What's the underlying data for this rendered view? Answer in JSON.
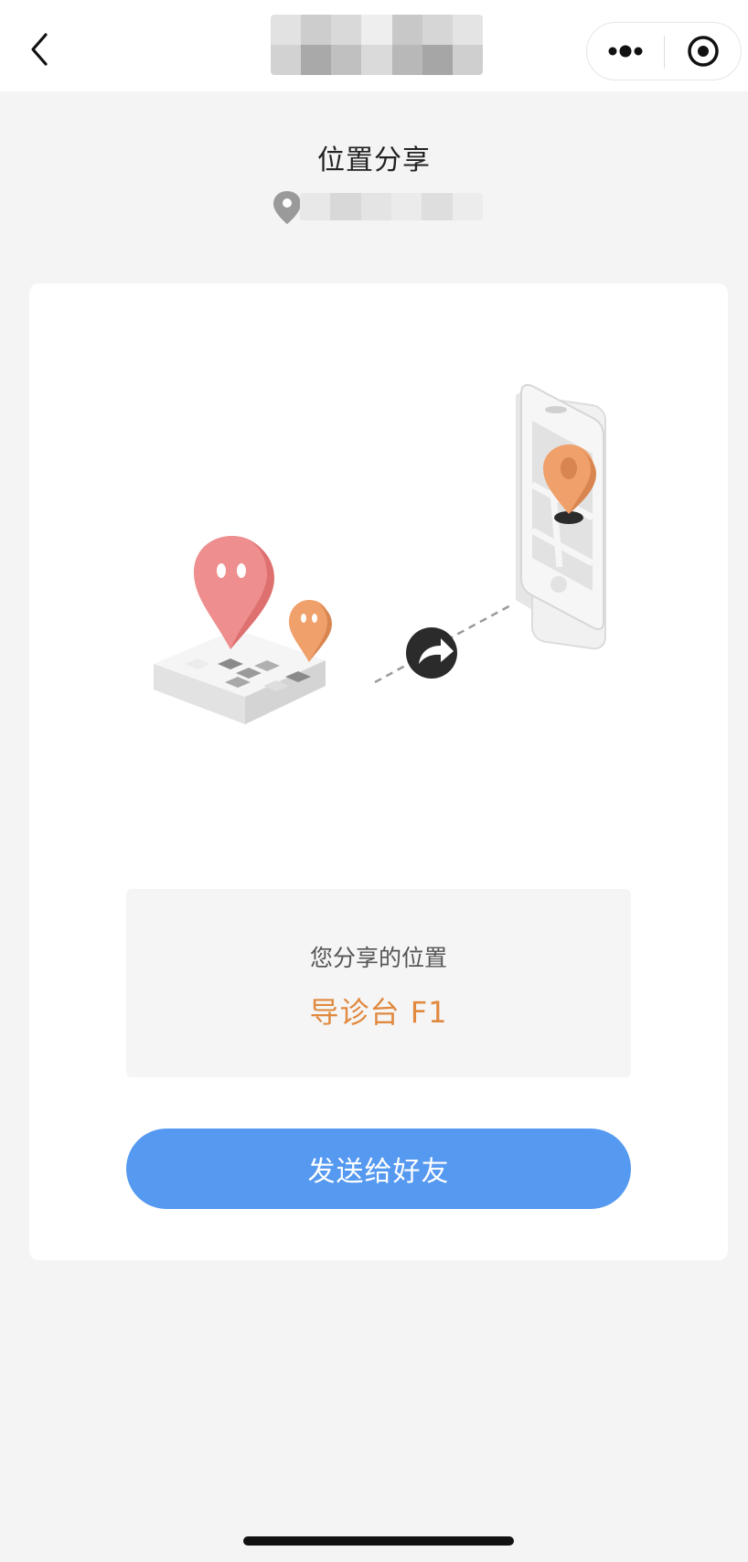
{
  "nav": {
    "back_icon": "chevron-left-icon",
    "more_icon": "more-dots-icon",
    "close_icon": "target-circle-icon",
    "title_mosaic": [
      "#e2e2e2",
      "#cdcdcd",
      "#d9d9d9",
      "#eeeeee",
      "#c8c8c8",
      "#d6d6d6",
      "#e4e4e4",
      "#d2d2d2",
      "#a9a9a9",
      "#c0c0c0",
      "#dadada",
      "#b8b8b8",
      "#a6a6a6",
      "#cfcfcf"
    ]
  },
  "header": {
    "title": "位置分享",
    "location_icon": "map-pin-icon"
  },
  "card": {
    "info_label": "您分享的位置",
    "info_value": "导诊台 F1",
    "send_button": "发送给好友",
    "share_icon": "share-arrow-icon"
  },
  "colors": {
    "primary_button": "#5599f0",
    "location_text": "#e0893f",
    "pin_large": "#ee8e8e",
    "pin_small": "#f0a06a"
  }
}
